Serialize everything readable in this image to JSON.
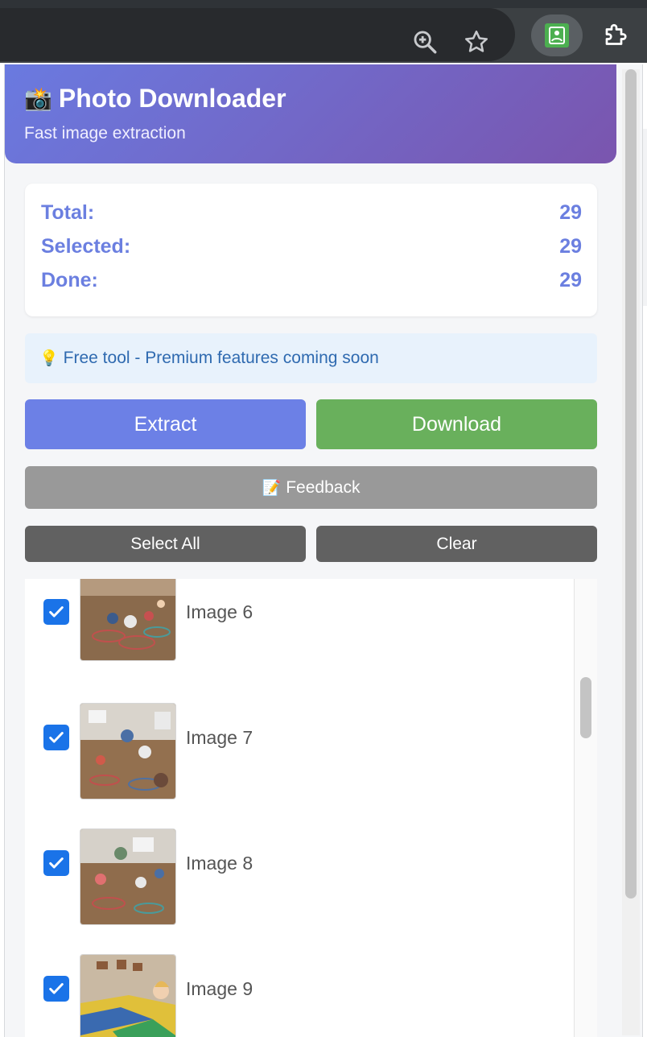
{
  "header": {
    "icon": "camera-flash-emoji",
    "title": "Photo Downloader",
    "subtitle": "Fast image extraction"
  },
  "stats": [
    {
      "label": "Total:",
      "value": "29"
    },
    {
      "label": "Selected:",
      "value": "29"
    },
    {
      "label": "Done:",
      "value": "29"
    }
  ],
  "notice": {
    "icon": "lightbulb-icon",
    "text": "Free tool - Premium features coming soon"
  },
  "buttons": {
    "extract": "Extract",
    "download": "Download",
    "feedback": "Feedback",
    "select_all": "Select All",
    "clear": "Clear"
  },
  "images": [
    {
      "label": "Image 6",
      "checked": true
    },
    {
      "label": "Image 7",
      "checked": true
    },
    {
      "label": "Image 8",
      "checked": true
    },
    {
      "label": "Image 9",
      "checked": true
    }
  ],
  "colors": {
    "header_start": "#6a7ae0",
    "header_end": "#7a55ae",
    "accent_blue": "#6c80e6",
    "download_green": "#69b05c",
    "checkbox_blue": "#1a73e8"
  }
}
